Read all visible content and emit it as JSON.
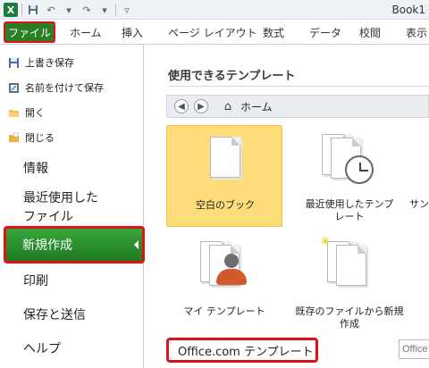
{
  "window": {
    "title": "Book1"
  },
  "ribbon": {
    "tabs": [
      "ファイル",
      "ホーム",
      "挿入",
      "ページ レイアウト",
      "数式",
      "データ",
      "校閲",
      "表示"
    ]
  },
  "backstage": {
    "commands": [
      "上書き保存",
      "名前を付けて保存",
      "開く",
      "閉じる"
    ],
    "nav": [
      "情報",
      "最近使用した\nファイル",
      "新規作成",
      "印刷",
      "保存と送信",
      "ヘルプ"
    ]
  },
  "templates": {
    "section_title": "使用できるテンプレート",
    "nav_location": "ホーム",
    "items": [
      "空白のブック",
      "最近使用したテンプ\nレート",
      "サン",
      "マイ テンプレート",
      "既存のファイルから新規\n作成"
    ],
    "office_section": "Office.com テンプレート",
    "search_placeholder": "Office"
  }
}
